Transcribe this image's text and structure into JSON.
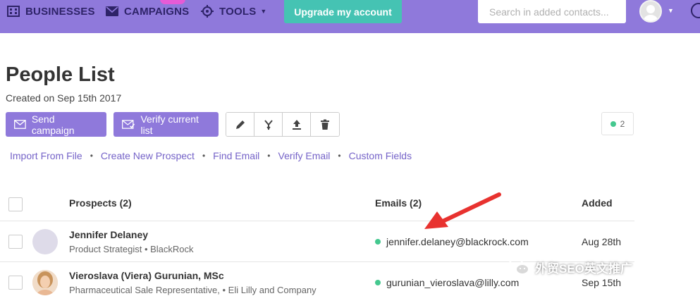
{
  "nav": {
    "businesses": "BUSINESSES",
    "campaigns": "CAMPAIGNS",
    "tools": "TOOLS",
    "upgrade": "Upgrade my account",
    "search_placeholder": "Search in added contacts..."
  },
  "page": {
    "title": "People List",
    "created": "Created on Sep 15th 2017"
  },
  "toolbar": {
    "send_campaign": "Send campaign",
    "verify_list": "Verify current list",
    "icons": [
      "pencil-icon",
      "merge-icon",
      "upload-icon",
      "trash-icon"
    ],
    "status_count": "2"
  },
  "links": [
    "Import From File",
    "Create New Prospect",
    "Find Email",
    "Verify Email",
    "Custom Fields"
  ],
  "table": {
    "headers": {
      "prospects": "Prospects (2)",
      "emails": "Emails (2)",
      "added": "Added"
    },
    "rows": [
      {
        "name": "Jennifer Delaney",
        "subtitle": "Product Strategist • BlackRock",
        "email": "jennifer.delaney@blackrock.com",
        "added": "Aug 28th"
      },
      {
        "name": "Vieroslava (Viera) Gurunian, MSc",
        "subtitle": "Pharmaceutical Sale Representative, • Eli Lilly and Company",
        "email": "gurunian_vieroslava@lilly.com",
        "added": "Sep 15th"
      }
    ]
  },
  "watermark": "外贸SEO英文推广",
  "colors": {
    "nav_bg": "#8f79db",
    "accent": "#45c3b3",
    "link": "#7563c8",
    "status_dot": "#44c88f",
    "arrow": "#e8322f"
  }
}
